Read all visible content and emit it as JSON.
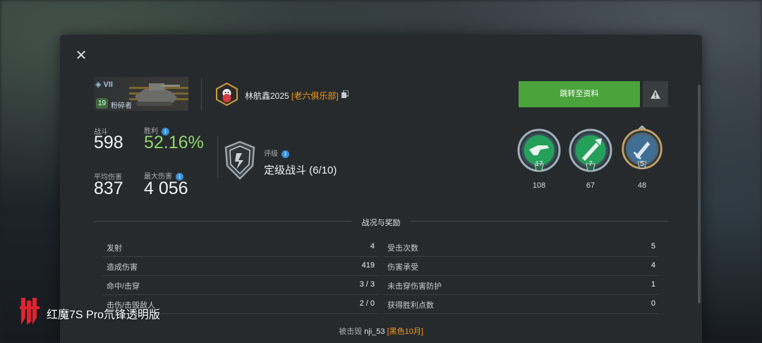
{
  "dialog": {
    "close_label": "✕"
  },
  "tank": {
    "tier": "VII",
    "level": "19",
    "mastery_title": "粉碎者"
  },
  "player": {
    "name": "林航鑫2025",
    "clan": "[老六俱乐部]"
  },
  "stats": {
    "battles_label": "战斗",
    "battles_value": "598",
    "winrate_label": "胜利",
    "winrate_value": "52.16%",
    "avg_damage_label": "平均伤害",
    "avg_damage_value": "837",
    "max_damage_label": "最大伤害",
    "max_damage_value": "4 056"
  },
  "rating": {
    "label": "评级",
    "value": "定级战斗 (6/10)"
  },
  "actions": {
    "profile_button": "跳转至资料"
  },
  "medals": [
    {
      "icon": "gun-medal-icon",
      "level": "17",
      "count": "108"
    },
    {
      "icon": "arrow-medal-icon",
      "level": "7",
      "count": "67"
    },
    {
      "icon": "sword-medal-icon",
      "level": "5",
      "count": "48"
    }
  ],
  "section": {
    "title": "战况与奖励"
  },
  "battle_stats_left": [
    {
      "label": "发射",
      "value": "4"
    },
    {
      "label": "造成伤害",
      "value": "419"
    },
    {
      "label": "命中/击穿",
      "value": "3 / 3"
    },
    {
      "label": "击伤/击毁敌人",
      "value": "2 / 0"
    }
  ],
  "battle_stats_right": [
    {
      "label": "受击次数",
      "value": "5"
    },
    {
      "label": "伤害承受",
      "value": "4"
    },
    {
      "label": "未击穿伤害防护",
      "value": "1"
    },
    {
      "label": "获得胜利点数",
      "value": "0"
    }
  ],
  "footer": {
    "prefix": "被击毁",
    "name": "nji_53",
    "clan": "[黑色10月]"
  },
  "watermark": {
    "text": "红魔7S Pro氘锋透明版"
  },
  "colors": {
    "accent_green": "#4aa33b",
    "winrate_green": "#8fd46a",
    "clan_orange": "#f59c18",
    "info_blue": "#3d8fd6"
  }
}
